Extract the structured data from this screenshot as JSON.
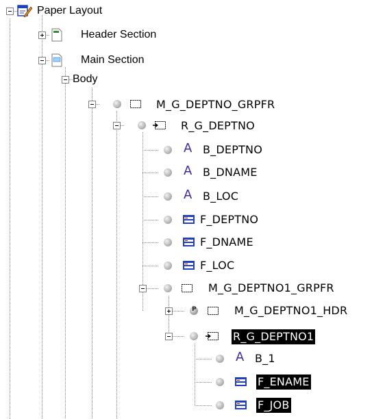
{
  "tree": {
    "root": {
      "label": "Paper Layout",
      "expanded": true
    },
    "header_section": {
      "label": "Header Section",
      "expanded": false
    },
    "main_section": {
      "label": "Main Section",
      "expanded": true
    },
    "body": {
      "label": "Body",
      "expanded": true
    },
    "m_g_deptno_grpfr": {
      "label": "M_G_DEPTNO_GRPFR",
      "expanded": true
    },
    "r_g_deptno": {
      "label": "R_G_DEPTNO",
      "expanded": true
    },
    "b_deptno": {
      "label": "B_DEPTNO"
    },
    "b_dname": {
      "label": "B_DNAME"
    },
    "b_loc": {
      "label": "B_LOC"
    },
    "f_deptno": {
      "label": "F_DEPTNO"
    },
    "f_dname": {
      "label": "F_DNAME"
    },
    "f_loc": {
      "label": "F_LOC"
    },
    "m_g_deptno01_grpfr": {
      "label": "M_G_DEPTNO1_GRPFR",
      "expanded": true
    },
    "m_g_deptno01_hdr": {
      "label": "M_G_DEPTNO1_HDR",
      "expanded": false,
      "badge": "P"
    },
    "r_g_deptno01": {
      "label": "R_G_DEPTNO1",
      "expanded": true,
      "selected": true
    },
    "b_1": {
      "label": "B_1"
    },
    "f_ename": {
      "label": "F_ENAME",
      "selected": true
    },
    "f_job": {
      "label": "F_JOB",
      "selected": true
    }
  },
  "icons": {
    "layout": "paper-layout-icon",
    "section": "section-page-icon",
    "frame": "frame-icon",
    "repeating_frame": "repeating-frame-icon",
    "text_boilerplate": "text-boilerplate-icon",
    "field": "field-icon"
  },
  "colors": {
    "selection_bg": "#000000",
    "selection_fg": "#ffffff",
    "text_icon": "#3a2aa6",
    "field_icon_blue": "#1f3fbf",
    "guide_line": "#808080"
  }
}
